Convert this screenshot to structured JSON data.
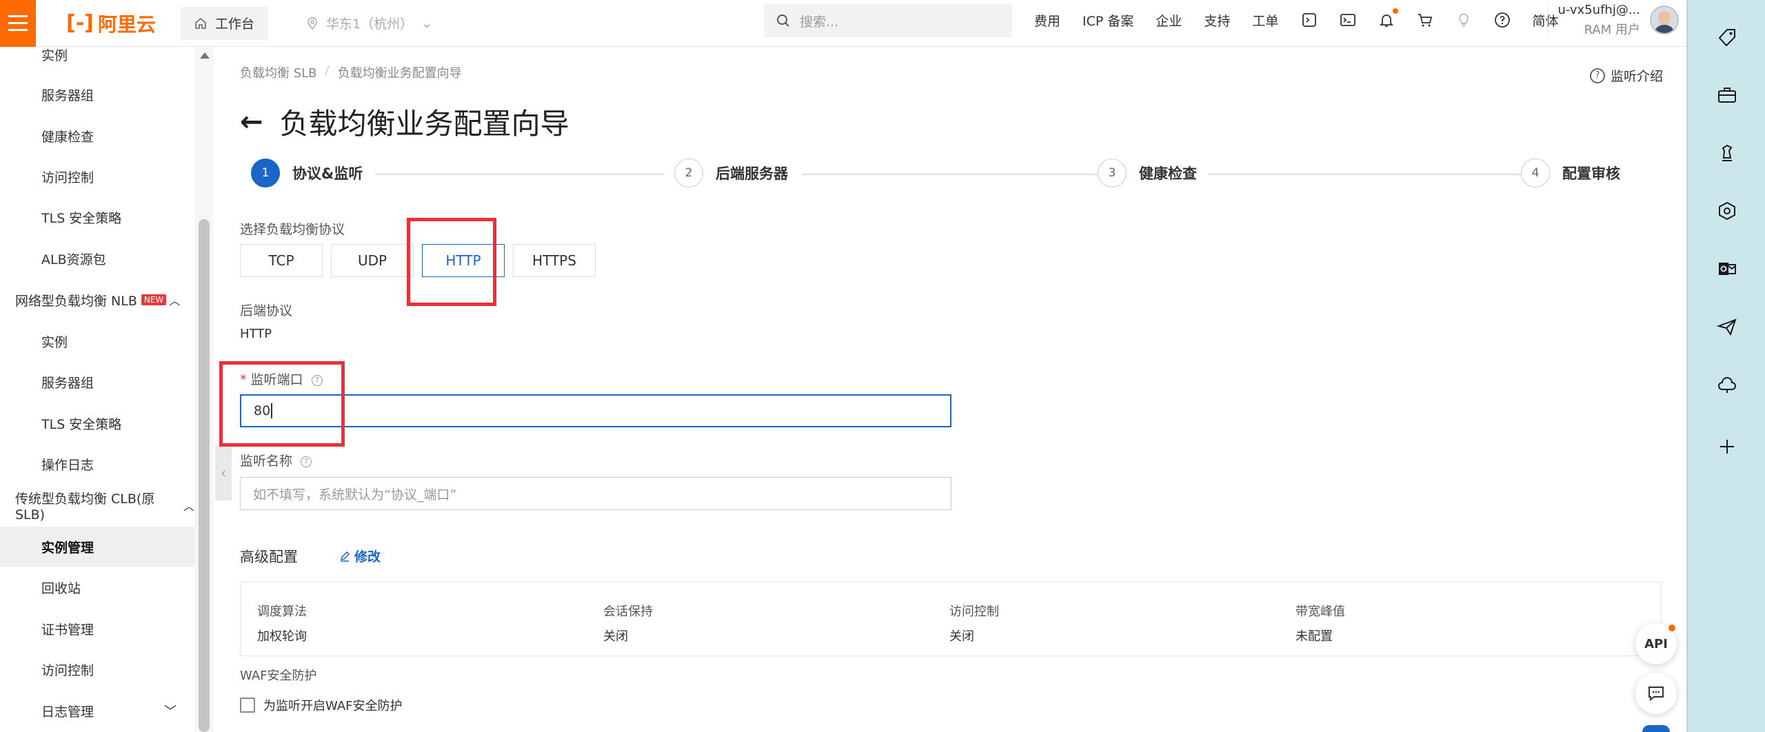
{
  "brand": {
    "logo_text": "阿里云",
    "logo_bracket": "[-]",
    "accent": "#ff6a00"
  },
  "topbar": {
    "workbench": "工作台",
    "region": "华东1（杭州）",
    "search_placeholder": "搜索...",
    "links": [
      "费用",
      "ICP 备案",
      "企业",
      "支持",
      "工单"
    ],
    "language": "简体",
    "user_name": "u-vx5ufhj@...",
    "user_role": "RAM 用户"
  },
  "sidebar": {
    "items": [
      {
        "label": "实例",
        "type": "sub"
      },
      {
        "label": "服务器组",
        "type": "sub"
      },
      {
        "label": "健康检查",
        "type": "sub"
      },
      {
        "label": "访问控制",
        "type": "sub"
      },
      {
        "label": "TLS 安全策略",
        "type": "sub"
      },
      {
        "label": "ALB资源包",
        "type": "sub"
      },
      {
        "label": "网络型负载均衡 NLB",
        "type": "group",
        "badge": "NEW"
      },
      {
        "label": "实例",
        "type": "sub"
      },
      {
        "label": "服务器组",
        "type": "sub"
      },
      {
        "label": "TLS 安全策略",
        "type": "sub"
      },
      {
        "label": "操作日志",
        "type": "sub"
      },
      {
        "label": "传统型负载均衡 CLB(原SLB)",
        "type": "group"
      },
      {
        "label": "实例管理",
        "type": "sub",
        "active": true
      },
      {
        "label": "回收站",
        "type": "sub"
      },
      {
        "label": "证书管理",
        "type": "sub"
      },
      {
        "label": "访问控制",
        "type": "sub"
      },
      {
        "label": "日志管理",
        "type": "sub"
      }
    ]
  },
  "breadcrumb": [
    "负载均衡 SLB",
    "负载均衡业务配置向导"
  ],
  "intro_link": "监听介绍",
  "page_title": "负载均衡业务配置向导",
  "steps": [
    {
      "num": "1",
      "label": "协议&监听",
      "active": true
    },
    {
      "num": "2",
      "label": "后端服务器"
    },
    {
      "num": "3",
      "label": "健康检查"
    },
    {
      "num": "4",
      "label": "配置审核"
    }
  ],
  "form": {
    "protocol_label": "选择负载均衡协议",
    "protocols": [
      "TCP",
      "UDP",
      "HTTP",
      "HTTPS"
    ],
    "selected_protocol": "HTTP",
    "backend_label": "后端协议",
    "backend_value": "HTTP",
    "port_required": "*",
    "port_label": "监听端口",
    "port_value": "80",
    "name_label": "监听名称",
    "name_placeholder": "如不填写，系统默认为“协议_端口”"
  },
  "advanced": {
    "title": "高级配置",
    "edit": "修改",
    "columns": [
      {
        "key": "调度算法",
        "value": "加权轮询"
      },
      {
        "key": "会话保持",
        "value": "关闭"
      },
      {
        "key": "访问控制",
        "value": "关闭"
      },
      {
        "key": "带宽峰值",
        "value": "未配置"
      }
    ]
  },
  "waf": {
    "title": "WAF安全防护",
    "checkbox_label": "为监听开启WAF安全防护",
    "checked": false
  },
  "fab": {
    "api": "API"
  },
  "highlight_color": "#e8313a"
}
